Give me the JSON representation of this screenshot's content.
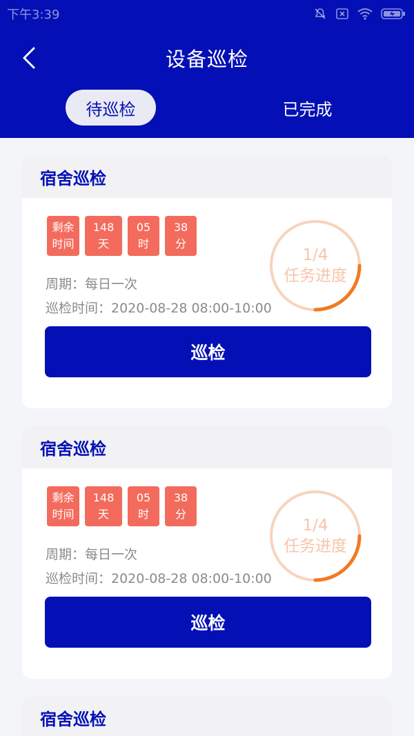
{
  "status_bar": {
    "time": "下午3:39"
  },
  "header": {
    "title": "设备巡检"
  },
  "tabs": [
    {
      "label": "待巡检",
      "active": true
    },
    {
      "label": "已完成",
      "active": false
    }
  ],
  "cards": [
    {
      "title": "宿舍巡检",
      "countdown": [
        {
          "top": "剩余",
          "bottom": "时间"
        },
        {
          "top": "148",
          "bottom": "天"
        },
        {
          "top": "05",
          "bottom": "时"
        },
        {
          "top": "38",
          "bottom": "分"
        }
      ],
      "period": "周期：每日一次",
      "time": "巡检时间：2020-08-28 08:00-10:00",
      "progress_text": "1/4",
      "progress_label": "任务进度",
      "progress_fraction": 0.25,
      "button_label": "巡检"
    },
    {
      "title": "宿舍巡检",
      "countdown": [
        {
          "top": "剩余",
          "bottom": "时间"
        },
        {
          "top": "148",
          "bottom": "天"
        },
        {
          "top": "05",
          "bottom": "时"
        },
        {
          "top": "38",
          "bottom": "分"
        }
      ],
      "period": "周期：每日一次",
      "time": "巡检时间：2020-08-28 08:00-10:00",
      "progress_text": "1/4",
      "progress_label": "任务进度",
      "progress_fraction": 0.25,
      "button_label": "巡检"
    },
    {
      "title": "宿舍巡检"
    }
  ],
  "colors": {
    "primary": "#0410b5",
    "chip": "#f36b5d",
    "ring_track": "#f8d3bd",
    "ring_fill": "#f17a22"
  },
  "icons": [
    "back-arrow-icon",
    "mute-icon",
    "no-sim-icon",
    "wifi-icon",
    "battery-icon"
  ]
}
